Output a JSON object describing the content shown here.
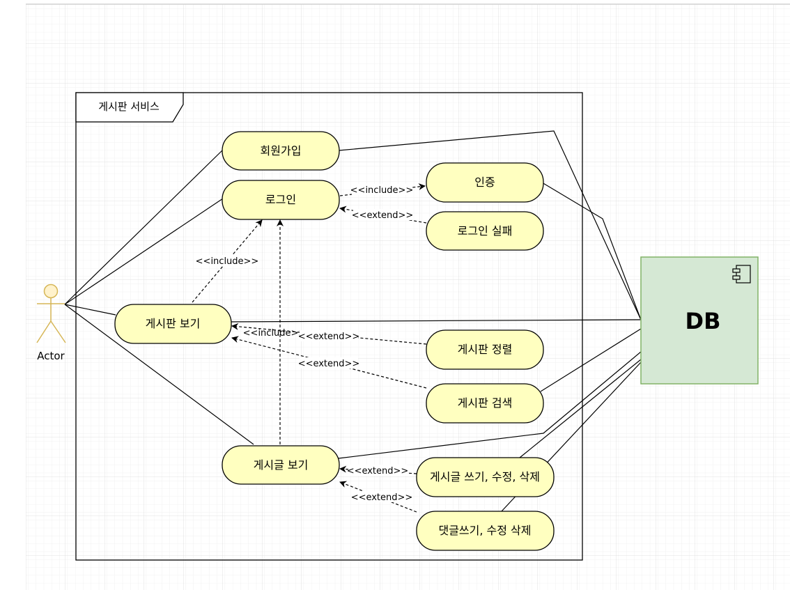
{
  "diagram": {
    "frame_title": "게시판 서비스",
    "actor_label": "Actor",
    "db_label": "DB",
    "use_cases": {
      "signup": "회원가입",
      "login": "로그인",
      "auth": "인증",
      "login_fail": "로그인 실패",
      "board_view": "게시판 보기",
      "board_sort": "게시판 정렬",
      "board_search": "게시판 검색",
      "post_view": "게시글 보기",
      "post_write": "게시글 쓰기, 수정, 삭제",
      "comment_write": "댓글쓰기, 수정 삭제"
    },
    "relation_labels": {
      "login_auth": "<<include>>",
      "login_fail": "<<extend>>",
      "board_login": "<<include>>",
      "post_board": "<<include>>",
      "sort_board": "<<extend>>",
      "search_board": "<<extend>>",
      "write_post": "<<extend>>",
      "comment_post": "<<extend>>"
    },
    "colors": {
      "use_case_fill": "#ffffc0",
      "actor_fill": "#fff2cc",
      "actor_stroke": "#d6b656",
      "db_fill": "#d5e8d4",
      "db_stroke": "#82b366",
      "grid": "#e6e6e6"
    }
  }
}
